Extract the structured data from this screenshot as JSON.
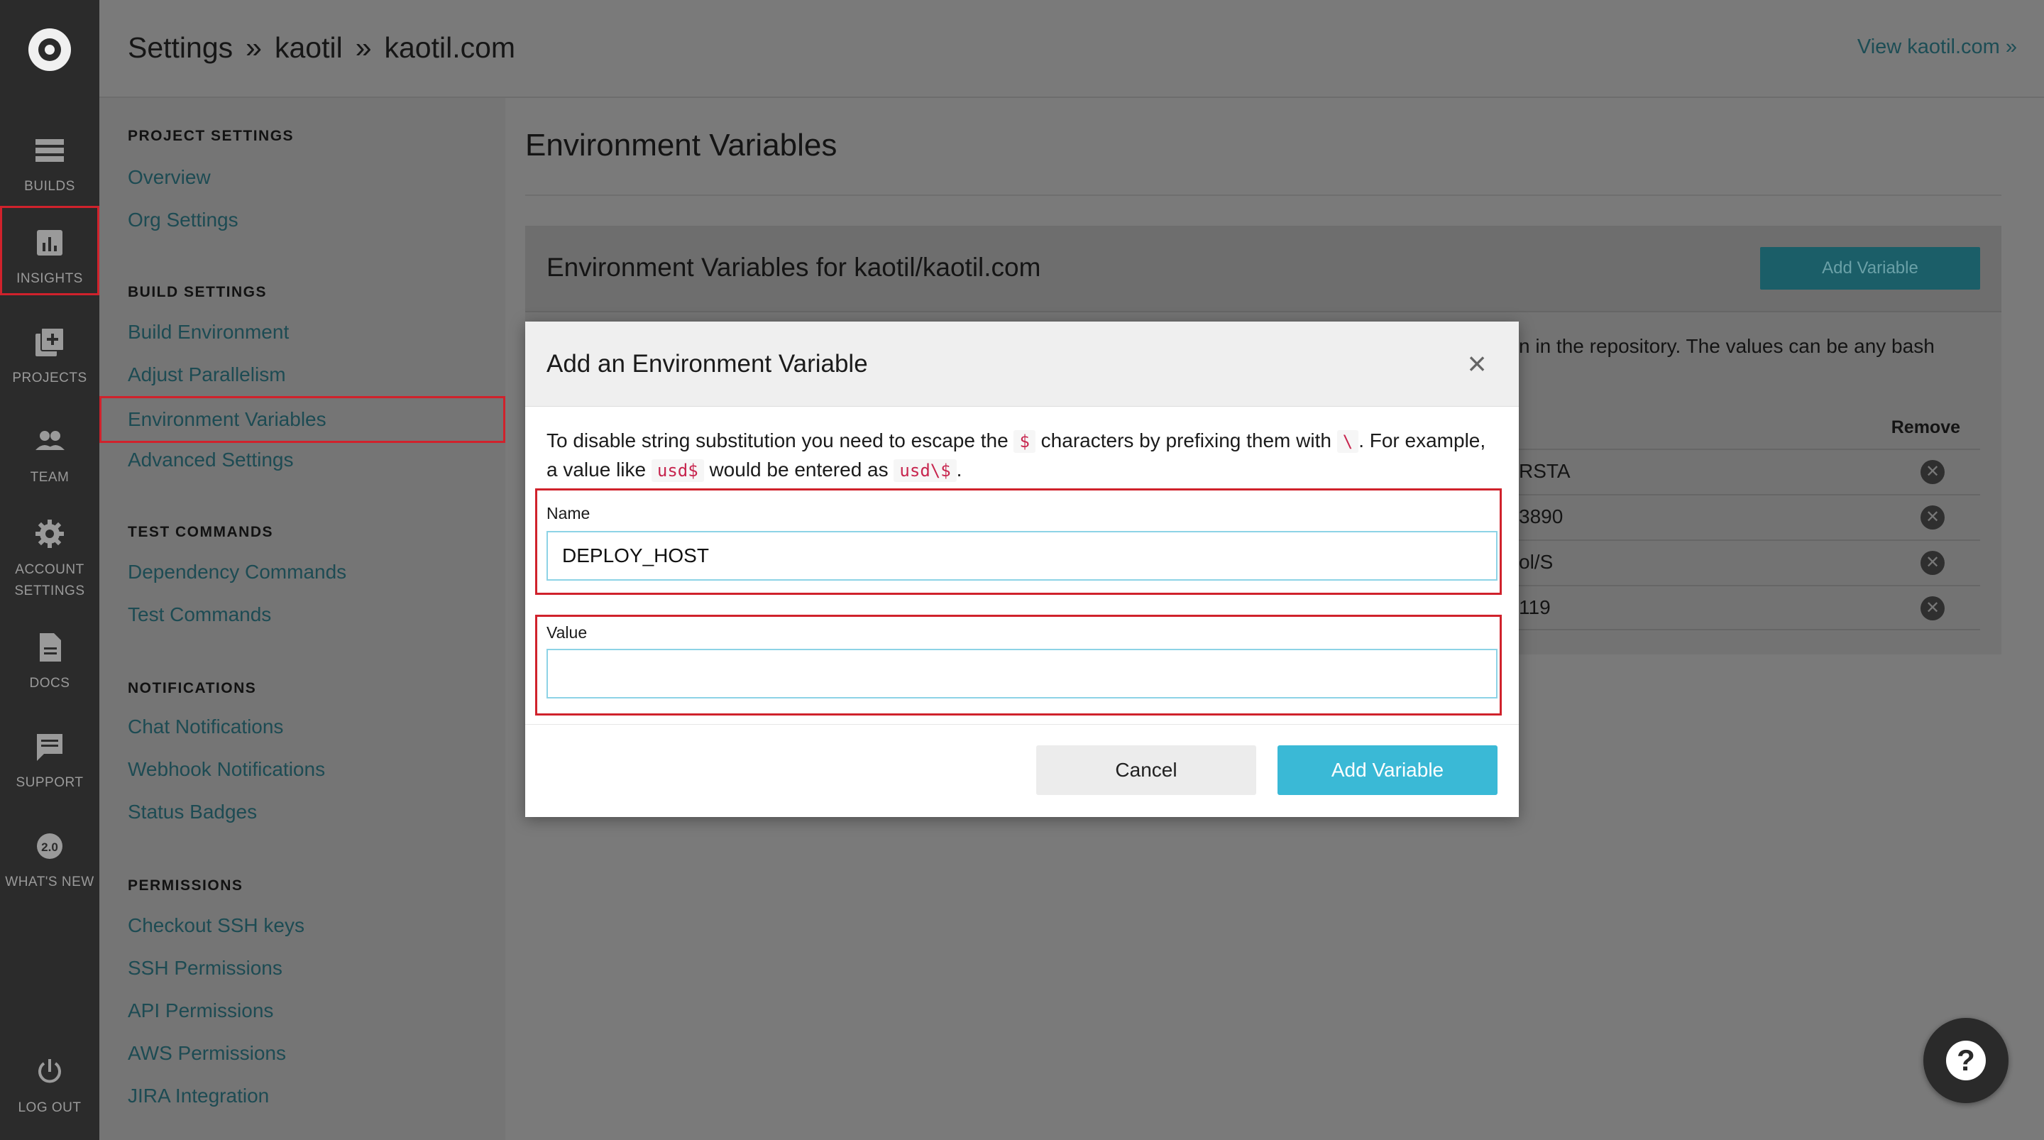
{
  "nav": {
    "items": [
      {
        "label": "BUILDS",
        "icon": "builds-icon"
      },
      {
        "label": "INSIGHTS",
        "icon": "insights-icon"
      },
      {
        "label": "PROJECTS",
        "icon": "projects-icon"
      },
      {
        "label": "TEAM",
        "icon": "team-icon"
      },
      {
        "label": "ACCOUNT SETTINGS",
        "line1": "ACCOUNT",
        "line2": "SETTINGS",
        "icon": "gear-icon"
      },
      {
        "label": "DOCS",
        "icon": "docs-icon"
      },
      {
        "label": "SUPPORT",
        "icon": "support-icon"
      },
      {
        "label": "WHAT'S NEW",
        "icon": "whats-new-icon",
        "badge": "2.0"
      },
      {
        "label": "LOG OUT",
        "icon": "power-icon"
      }
    ]
  },
  "header": {
    "crumb1": "Settings",
    "crumb2": "kaotil",
    "crumb3": "kaotil.com",
    "sep": "»",
    "view_link": "View kaotil.com »"
  },
  "sidebar": {
    "project_settings": {
      "title": "PROJECT SETTINGS",
      "links": [
        "Overview",
        "Org Settings"
      ]
    },
    "build_settings": {
      "title": "BUILD SETTINGS",
      "links": [
        "Build Environment",
        "Adjust Parallelism",
        "Environment Variables",
        "Advanced Settings"
      ]
    },
    "test_commands": {
      "title": "TEST COMMANDS",
      "links": [
        "Dependency Commands",
        "Test Commands"
      ]
    },
    "notifications": {
      "title": "NOTIFICATIONS",
      "links": [
        "Chat Notifications",
        "Webhook Notifications",
        "Status Badges"
      ]
    },
    "permissions": {
      "title": "PERMISSIONS",
      "links": [
        "Checkout SSH keys",
        "SSH Permissions",
        "API Permissions",
        "AWS Permissions",
        "JIRA Integration"
      ]
    }
  },
  "main": {
    "title": "Environment Variables",
    "panel_title": "Environment Variables for kaotil/kaotil.com",
    "add_button": "Add Variable",
    "desc_partial": "n in the repository. The values can be any bash",
    "remove_header": "Remove",
    "rows": [
      "RSTA",
      "3890",
      "ol/S",
      "119"
    ]
  },
  "modal": {
    "title": "Add an Environment Variable",
    "text_1": "To disable string substitution you need to escape the",
    "code_1": "$",
    "text_2": "characters by prefixing them with",
    "code_2": "\\",
    "text_3": ". For example,",
    "text_4": "a value like",
    "code_3": "usd$",
    "text_5": "would be entered as",
    "code_4": "usd\\$",
    "text_6": ".",
    "name_label": "Name",
    "name_value": "DEPLOY_HOST",
    "value_label": "Value",
    "value_value": "",
    "cancel": "Cancel",
    "submit": "Add Variable"
  },
  "help": {
    "glyph": "?"
  },
  "colors": {
    "link": "#1d4b53",
    "accent": "#3ab9d6",
    "highlight": "#d0222c"
  }
}
